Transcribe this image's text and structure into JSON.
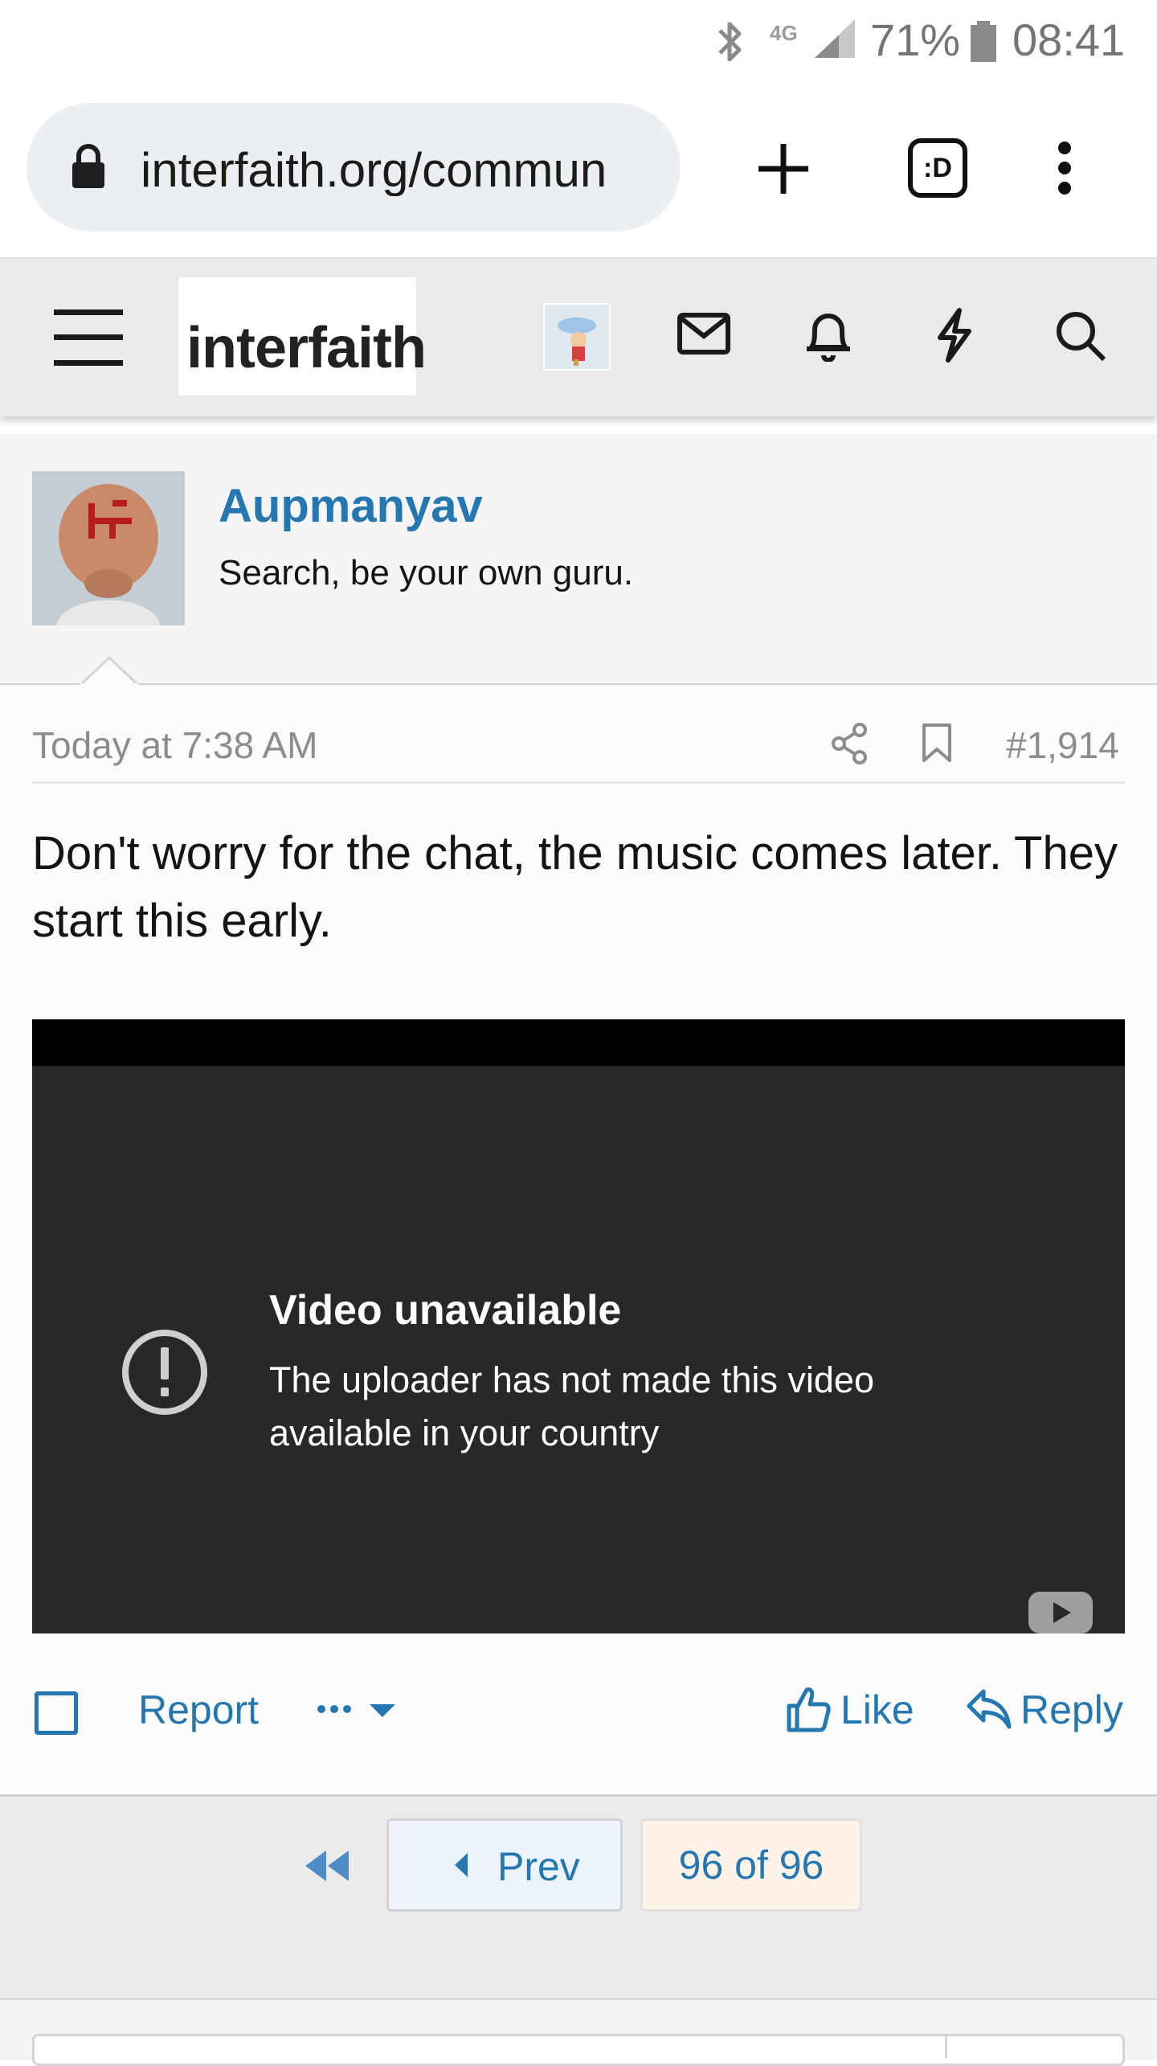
{
  "status_bar": {
    "network": "4G",
    "battery": "71%",
    "time": "08:41"
  },
  "browser": {
    "url": "interfaith.org/commun",
    "tab_switcher_label": ":D"
  },
  "site": {
    "logo_text": "interfaith"
  },
  "post": {
    "author": "Aupmanyav",
    "author_title": "Search, be your own guru.",
    "date": "Today at 7:38 AM",
    "post_number": "#1,914",
    "text": "Don't worry for the chat, the music comes later. They start this early.",
    "video": {
      "title": "Video unavailable",
      "message": "The uploader has not made this video available in your country"
    },
    "actions": {
      "report": "Report",
      "like": "Like",
      "reply": "Reply"
    }
  },
  "pagination": {
    "prev": "Prev",
    "current": "96 of 96"
  },
  "colors": {
    "link": "#2577b1",
    "header_bg": "#eaeaea",
    "video_bg": "#282828"
  }
}
